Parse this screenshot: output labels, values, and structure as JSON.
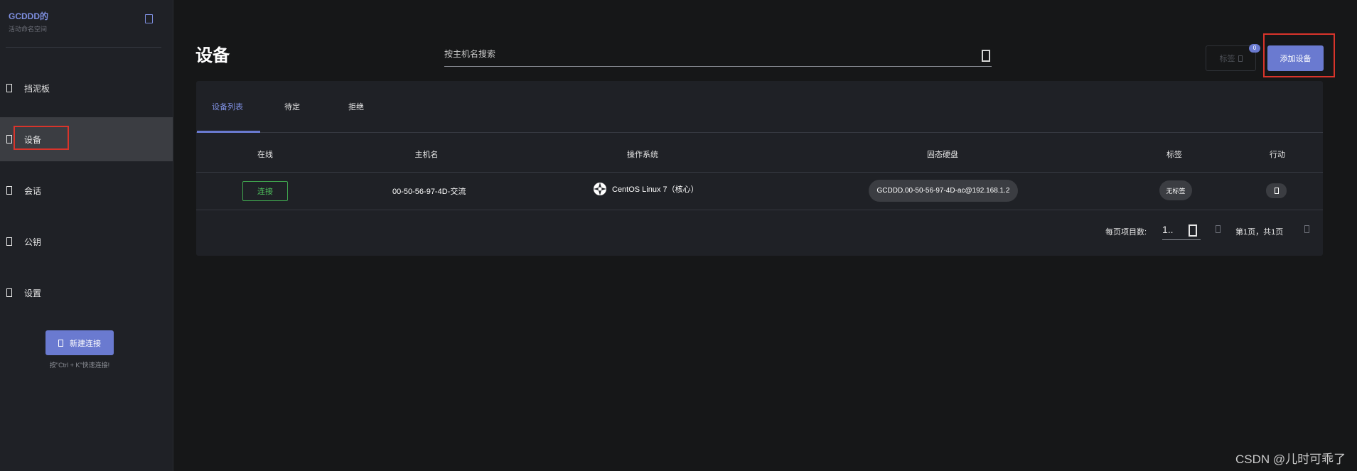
{
  "sidebar": {
    "brand_name": "GCDDD的",
    "brand_sub": "活动命名空间",
    "items": [
      {
        "label": "挡泥板",
        "icon": "dashboard-icon"
      },
      {
        "label": "设备",
        "icon": "devices-icon"
      },
      {
        "label": "会话",
        "icon": "sessions-icon"
      },
      {
        "label": "公钥",
        "icon": "public-key-icon"
      },
      {
        "label": "设置",
        "icon": "settings-icon"
      }
    ],
    "active_item": "设备",
    "new_connection_label": "新建连接",
    "new_connection_hint": "按\"Ctrl + K\"快速连接!"
  },
  "header": {
    "title": "设备",
    "search_placeholder": "按主机名搜索",
    "tag_button_label": "标签",
    "tag_badge_count": "0",
    "add_device_label": "添加设备"
  },
  "tabs": [
    {
      "label": "设备列表",
      "active": true
    },
    {
      "label": "待定",
      "active": false
    },
    {
      "label": "拒绝",
      "active": false
    }
  ],
  "table": {
    "columns": [
      "在线",
      "主机名",
      "操作系统",
      "固态硬盘",
      "标签",
      "行动"
    ],
    "rows": [
      {
        "online_button": "连接",
        "hostname": "00-50-56-97-4D-交流",
        "os": "CentOS Linux 7（核心）",
        "ssh": "GCDDD.00-50-56-97-4D-ac@192.168.1.2",
        "tag": "无标签"
      }
    ]
  },
  "pagination": {
    "per_page_label": "每页项目数:",
    "per_page_value": "1..",
    "page_info": "第1页，共1页"
  },
  "watermark": "CSDN @儿时可乖了",
  "colors": {
    "accent": "#6a7ad0",
    "online_green": "#4ebd5c",
    "highlight_red": "#d9342b",
    "background": "#161718",
    "panel": "#1f2126"
  }
}
